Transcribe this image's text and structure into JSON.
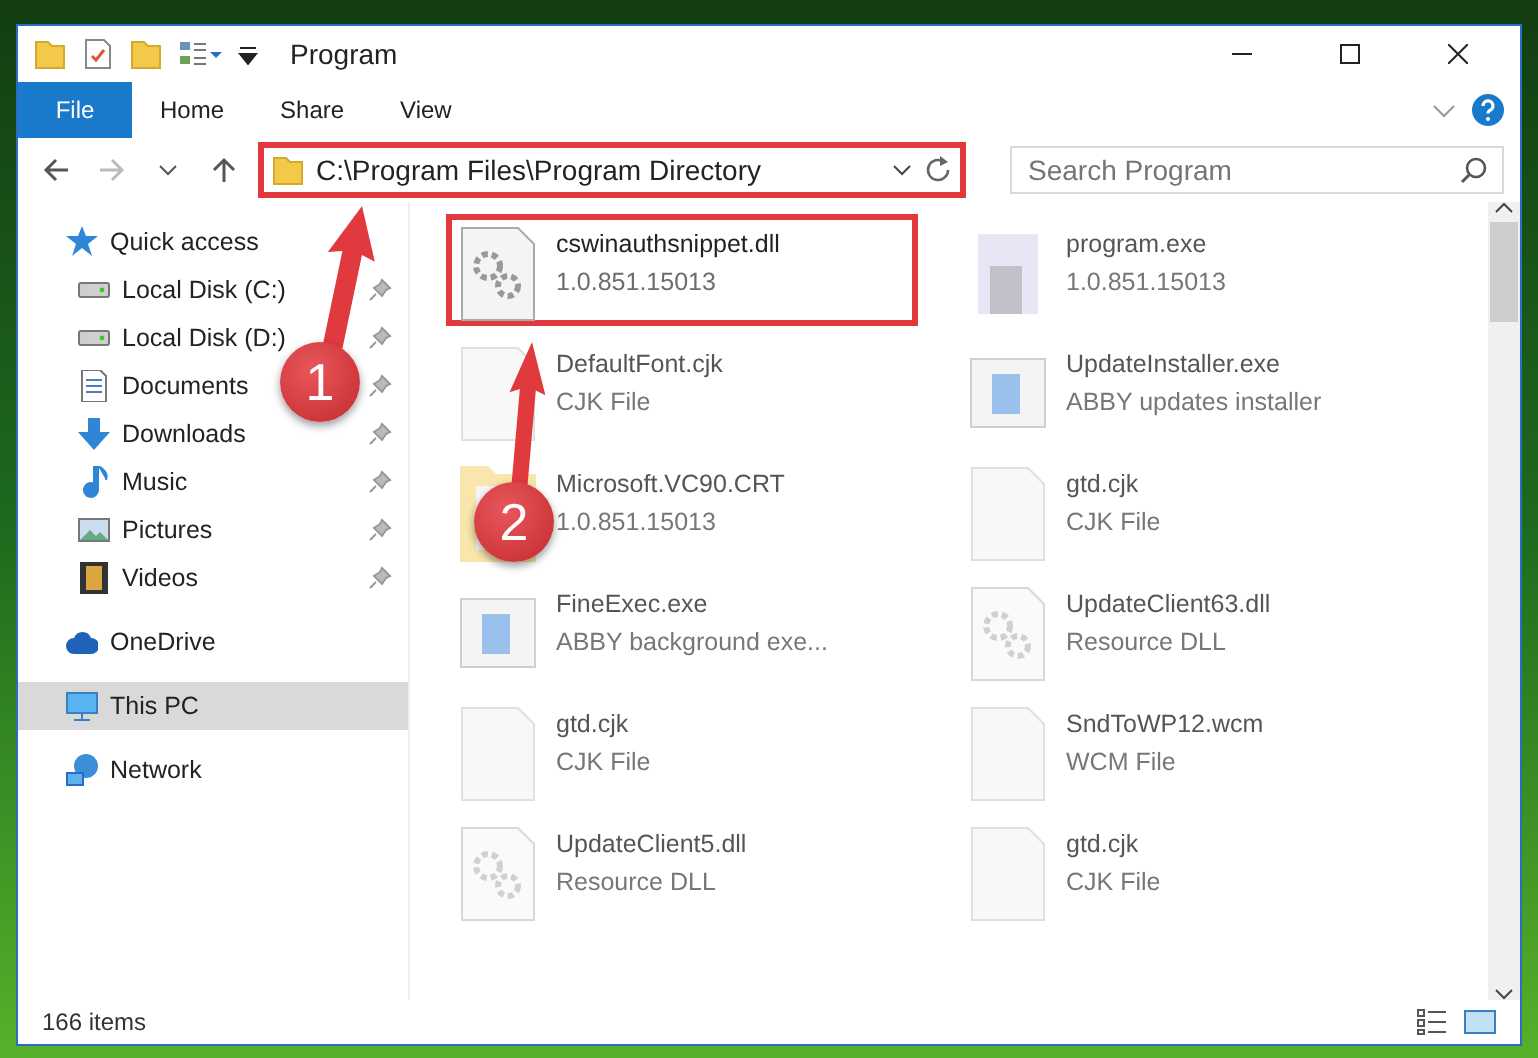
{
  "window": {
    "title": "Program"
  },
  "ribbon": {
    "tabs": [
      {
        "label": "File",
        "selected": true
      },
      {
        "label": "Home",
        "selected": false
      },
      {
        "label": "Share",
        "selected": false
      },
      {
        "label": "View",
        "selected": false
      }
    ]
  },
  "address": {
    "path": "C:\\Program Files\\Program Directory",
    "highlighted": true
  },
  "search": {
    "placeholder": "Search Program"
  },
  "sidebar": {
    "items": [
      {
        "label": "Quick access",
        "kind": "star",
        "selected": false,
        "children": [
          {
            "label": "Local Disk (C:)",
            "kind": "drive",
            "pinned": true,
            "selected": false
          },
          {
            "label": "Local Disk (D:)",
            "kind": "drive",
            "pinned": true,
            "selected": false
          },
          {
            "label": "Documents",
            "kind": "doc",
            "pinned": true,
            "selected": false
          },
          {
            "label": "Downloads",
            "kind": "download",
            "pinned": true,
            "selected": false
          },
          {
            "label": "Music",
            "kind": "music",
            "pinned": true,
            "selected": false
          },
          {
            "label": "Pictures",
            "kind": "picture",
            "pinned": true,
            "selected": false
          },
          {
            "label": "Videos",
            "kind": "video",
            "pinned": true,
            "selected": false
          }
        ]
      },
      {
        "label": "OneDrive",
        "kind": "cloud",
        "selected": false
      },
      {
        "label": "This PC",
        "kind": "pc",
        "selected": true
      },
      {
        "label": "Network",
        "kind": "network",
        "selected": false
      }
    ]
  },
  "files": [
    {
      "name": "cswinauthsnippet.dll",
      "detail": "1.0.851.15013",
      "kind": "gear",
      "highlighted": true,
      "blurred": false
    },
    {
      "name": "program.exe",
      "detail": "1.0.851.15013",
      "kind": "app",
      "highlighted": false,
      "blurred": true
    },
    {
      "name": "DefaultFont.cjk",
      "detail": "CJK File",
      "kind": "blank",
      "highlighted": false,
      "blurred": true
    },
    {
      "name": "UpdateInstaller.exe",
      "detail": "ABBY updates installer",
      "kind": "window",
      "highlighted": false,
      "blurred": true
    },
    {
      "name": "Microsoft.VC90.CRT",
      "detail": "1.0.851.15013",
      "kind": "folder",
      "highlighted": false,
      "blurred": true
    },
    {
      "name": "gtd.cjk",
      "detail": "CJK File",
      "kind": "blank",
      "highlighted": false,
      "blurred": true
    },
    {
      "name": "FineExec.exe",
      "detail": "ABBY background exe...",
      "kind": "window",
      "highlighted": false,
      "blurred": true
    },
    {
      "name": "UpdateClient63.dll",
      "detail": "Resource DLL",
      "kind": "gear",
      "highlighted": false,
      "blurred": true
    },
    {
      "name": "gtd.cjk",
      "detail": "CJK File",
      "kind": "blank",
      "highlighted": false,
      "blurred": true
    },
    {
      "name": "SndToWP12.wcm",
      "detail": "WCM File",
      "kind": "blank",
      "highlighted": false,
      "blurred": true
    },
    {
      "name": "UpdateClient5.dll",
      "detail": "Resource DLL",
      "kind": "gear",
      "highlighted": false,
      "blurred": true
    },
    {
      "name": "gtd.cjk",
      "detail": "CJK File",
      "kind": "blank",
      "highlighted": false,
      "blurred": true
    }
  ],
  "status_bar": {
    "count": "166 items"
  },
  "callouts": [
    {
      "label": "1"
    },
    {
      "label": "2"
    }
  ]
}
